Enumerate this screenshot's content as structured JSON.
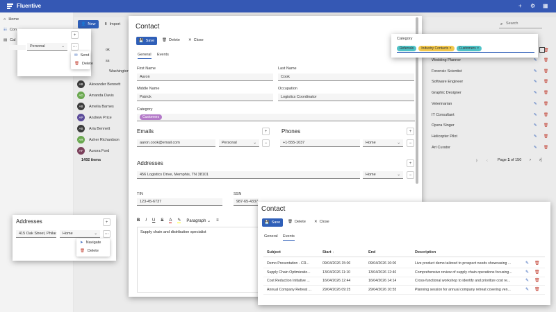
{
  "app": {
    "title": "Fluentive"
  },
  "nav": {
    "home": "Home",
    "contacts": "Con",
    "calendar": "Cal"
  },
  "toolbar": {
    "new": "New",
    "import": "Import",
    "search_placeholder": "Search"
  },
  "people": [
    {
      "initials": "AB",
      "name": "Alexander Bennett",
      "color": "#3b3b3b"
    },
    {
      "initials": "AD",
      "name": "Amanda Davis",
      "color": "#6aa84f"
    },
    {
      "initials": "AB",
      "name": "Amelia Barnes",
      "color": "#3b3b3b"
    },
    {
      "initials": "AP",
      "name": "Andrew Price",
      "color": "#5b4b9a"
    },
    {
      "initials": "AB",
      "name": "Aria Bennett",
      "color": "#3b3b3b"
    },
    {
      "initials": "AR",
      "name": "Asher Richardson",
      "color": "#6aa84f"
    },
    {
      "initials": "AF",
      "name": "Aurora Ford",
      "color": "#7a3f5a"
    }
  ],
  "partial_names": {
    "a": "ok",
    "b": "ss",
    "c": "Washington"
  },
  "items_count": "1492 items",
  "occupations": [
    "Wedding Planner",
    "Forensic Scientist",
    "Software Engineer",
    "Graphic Designer",
    "Veterinarian",
    "IT Consultant",
    "Opera Singer",
    "Helicopter Pilot",
    "Art Curator"
  ],
  "pagination": {
    "page": "Page",
    "current": "1",
    "of": "of 150"
  },
  "contact_dialog": {
    "title": "Contact",
    "save": "Save",
    "delete": "Delete",
    "close": "Close",
    "tabs": {
      "general": "General",
      "events": "Events"
    },
    "first_name_label": "First Name",
    "first_name": "Aaron",
    "last_name_label": "Last Name",
    "last_name": "Cook",
    "middle_name_label": "Middle Name",
    "middle_name": "Patrick",
    "occupation_label": "Occupation",
    "occupation": "Logistics Coordinator",
    "category_label": "Category",
    "category_chip": "Customers",
    "emails_title": "Emails",
    "email": "aaron.cook@email.com",
    "email_type": "Personal",
    "phones_title": "Phones",
    "phone": "+1-555-1037",
    "phone_type": "Home",
    "addresses_title": "Addresses",
    "address": "456 Logistics Drive, Memphis, TN 38101",
    "address_type": "Home",
    "tin_label": "TIN",
    "tin": "123-45-6737",
    "ssn_label": "SSN",
    "ssn": "987-65-4337",
    "paragraph": "Paragraph",
    "notes": "Supply chain and distribution specialist"
  },
  "category_popup": {
    "label": "Category",
    "chips": [
      "Referrals",
      "Industry Contacts",
      "Customers"
    ]
  },
  "email_menu": {
    "type": "Personal",
    "send": "Send",
    "delete": "Delete"
  },
  "address_popup": {
    "title": "Addresses",
    "address": "415 Oak Street, Philac",
    "type": "Home",
    "navigate": "Navigate",
    "delete": "Delete"
  },
  "events_dialog": {
    "title": "Contact",
    "save": "Save",
    "delete": "Delete",
    "close": "Close",
    "tabs": {
      "general": "General",
      "events": "Events"
    },
    "columns": {
      "subject": "Subject",
      "start": "Start",
      "end": "End",
      "description": "Description"
    },
    "rows": [
      {
        "subject": "Demo Presentation - CR...",
        "start": "09/04/2026 15:00",
        "end": "09/04/2026 16:00",
        "description": "Live product demo tailored to prospect needs showcasing ..."
      },
      {
        "subject": "Supply Chain Optimizatio...",
        "start": "13/04/2026 11:10",
        "end": "13/04/2026 12:40",
        "description": "Comprehensive review of supply chain operations focusing..."
      },
      {
        "subject": "Cost Reduction Initiative ...",
        "start": "16/04/2026 12:44",
        "end": "16/04/2026 14:14",
        "description": "Cross-functional workshop to identify and prioritize cost re..."
      },
      {
        "subject": "Annual Company Retreat ...",
        "start": "29/04/2026 09:25",
        "end": "29/04/2026 10:55",
        "description": "Planning session for annual company retreat covering ven..."
      }
    ]
  }
}
